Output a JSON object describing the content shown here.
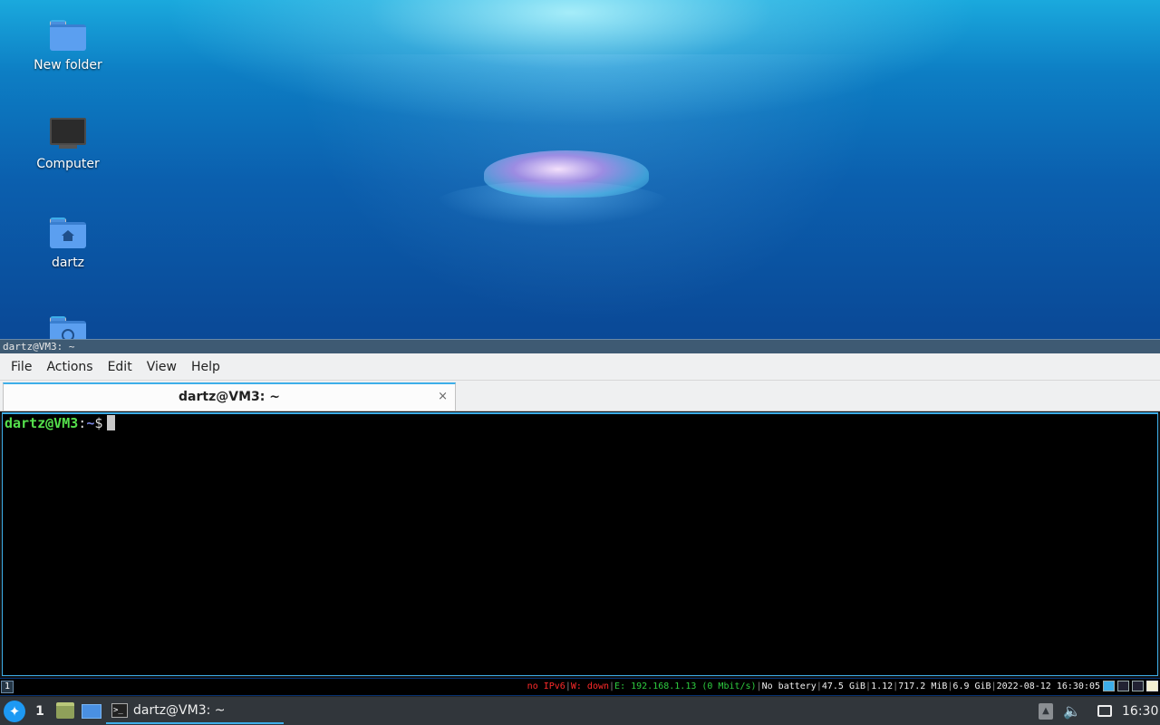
{
  "desktop": {
    "icons": [
      {
        "label": "New folder",
        "icon": "folder-icon"
      },
      {
        "label": "Computer",
        "icon": "computer-icon"
      },
      {
        "label": "dartz",
        "icon": "home-folder-icon"
      },
      {
        "label": "",
        "icon": "network-folder-icon"
      }
    ]
  },
  "terminal": {
    "window_title": "dartz@VM3: ~",
    "menu": [
      "File",
      "Actions",
      "Edit",
      "View",
      "Help"
    ],
    "tab_label": "dartz@VM3: ~",
    "tab_close": "×",
    "prompt_user": "dartz@VM3",
    "prompt_colon": ":",
    "prompt_dir": "~",
    "prompt_symbol": "$",
    "colors": {
      "prompt_user": "#55e04c",
      "prompt_dir": "#7a86e0",
      "accent": "#3daee9"
    }
  },
  "statusbar": {
    "workspace": "1",
    "ipv6": "no IPv6",
    "wifi": "W: down",
    "ethernet": "E: 192.168.1.13 (0 Mbit/s)",
    "battery": "No battery",
    "disk": "47.5 GiB",
    "load": "1.12",
    "memory": "717.2 MiB",
    "swap": "6.9 GiB",
    "datetime": "2022-08-12 16:30:05",
    "separator": "|"
  },
  "taskbar": {
    "start_icon": "start-menu-icon",
    "workspace": "1",
    "task_label": "dartz@VM3: ~",
    "clock": "16:30",
    "volume_icon": "volume-icon",
    "network_icon": "network-icon"
  }
}
